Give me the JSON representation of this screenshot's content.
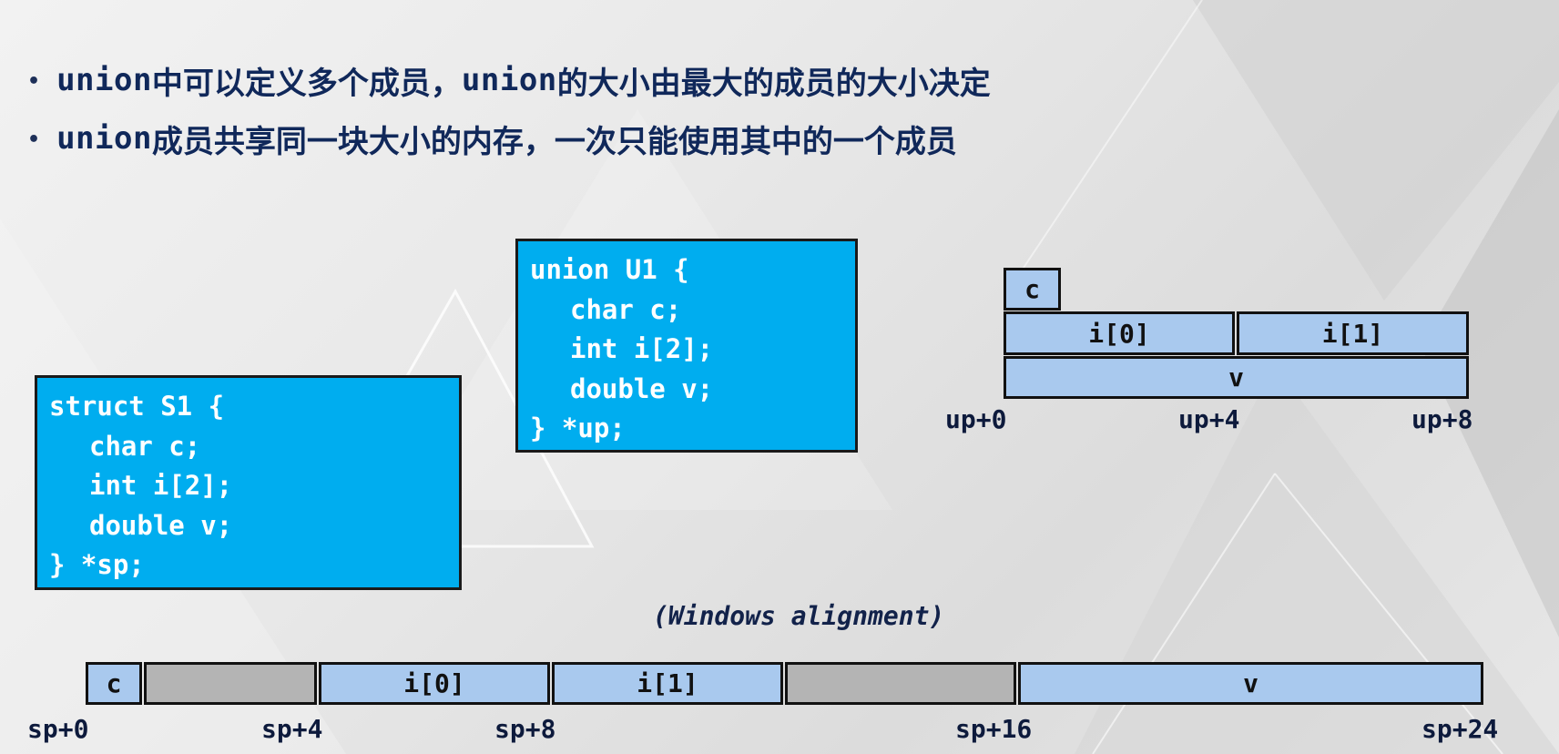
{
  "bullets": [
    {
      "code": "union",
      "text": "中可以定义多个成员，",
      "code2": "union",
      "text2": "的大小由最大的成员的大小决定"
    },
    {
      "code": "union",
      "text": "成员共享同一块大小的内存，一次只能使用其中的一个成员"
    }
  ],
  "struct_code": [
    "struct S1 {",
    "char c;",
    "int i[2];",
    "double v;",
    "} *sp;"
  ],
  "union_code": [
    "union U1 {",
    "char c;",
    "int i[2];",
    "double v;",
    "} *up;"
  ],
  "union_layout": {
    "cells": [
      "c",
      "i[0]",
      "i[1]",
      "v"
    ],
    "offsets": [
      "up+0",
      "up+4",
      "up+8"
    ]
  },
  "struct_layout": {
    "cells": [
      "c",
      "",
      "i[0]",
      "i[1]",
      "",
      "v"
    ],
    "offsets": [
      "sp+0",
      "sp+4",
      "sp+8",
      "sp+16",
      "sp+24"
    ]
  },
  "alignment_note": "(Windows alignment)",
  "colors": {
    "code_box": "#00adef",
    "member_cell": "#a9c9ee",
    "padding_cell": "#b4b4b4",
    "heading_text": "#10285a"
  }
}
